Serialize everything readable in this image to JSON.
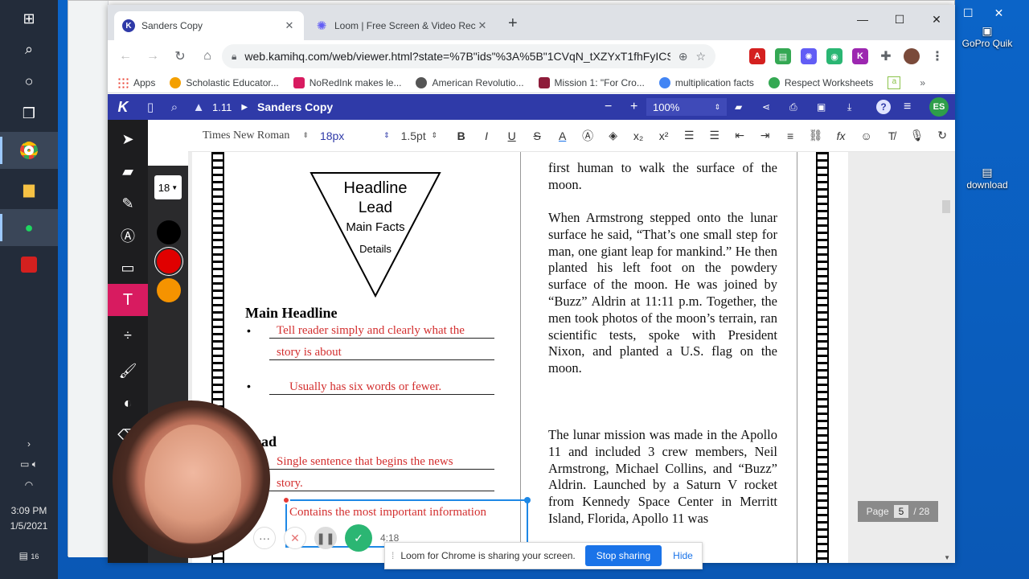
{
  "taskbar": {
    "time": "3:09 PM",
    "date": "1/5/2021",
    "notifications": "16"
  },
  "desktop": {
    "icons": [
      {
        "label": "GoPro Quik"
      },
      {
        "label": "download"
      }
    ]
  },
  "chrome": {
    "tabs": [
      {
        "title": "Sanders Copy",
        "icon": "K"
      },
      {
        "title": "Loom | Free Screen & Video Rec"
      }
    ],
    "url": "web.kamihq.com/web/viewer.html?state=%7B\"ids\"%3A%5B\"1CVqN_tXZYxT1fhFyICSS...",
    "profile": "ES",
    "bookmarks": [
      {
        "label": "Apps",
        "color": "#ea4335"
      },
      {
        "label": "Scholastic Educator...",
        "color": "#f4a000"
      },
      {
        "label": "NoRedInk makes le...",
        "color": "#d81b60"
      },
      {
        "label": "American Revolutio...",
        "color": "#555555"
      },
      {
        "label": "Mission 1: \"For Cro...",
        "color": "#8e1c3a"
      },
      {
        "label": "multiplication facts",
        "color": "#4285f4"
      },
      {
        "label": "Respect Worksheets",
        "color": "#34a853"
      }
    ]
  },
  "kami": {
    "breadcrumb_num": "1.11",
    "doc_title": "Sanders Copy",
    "zoom": "100%",
    "font": "Times New Roman",
    "font_size": "18px",
    "line_width": "1.5pt",
    "size_chip": "18",
    "page_label": "Page",
    "page_current": "5",
    "page_total": "/ 28"
  },
  "doc": {
    "pyramid": [
      "Headline",
      "Lead",
      "Main Facts",
      "Details"
    ],
    "main_headline": "Main Headline",
    "bullet1": "Tell reader simply and clearly what the",
    "bullet1b": "story is about",
    "bullet2": "Usually has six words or fewer.",
    "lead_heading": "ead",
    "lead1": "Single sentence that begins the news",
    "lead1b": "story.",
    "lead2": "Contains the most important information",
    "right_p0": "first human to walk the surface of the moon.",
    "right_p1": "When Armstrong stepped onto the lunar surface he said, “That’s one small step for man, one giant leap for mankind.” He then planted his left foot on the powdery surface of the moon. He was joined by “Buzz” Aldrin at 11:11 p.m. Together, the men took photos of the moon’s terrain, ran scientific tests, spoke with President Nixon, and planted a U.S. flag on the moon.",
    "right_p2": "The lunar mission was made in the Apollo 11 and included 3 crew members, Neil Armstrong, Michael Collins, and “Buzz” Aldrin. Launched by a Saturn V rocket from Kennedy Space Center in Merritt Island, Florida, Apollo 11 was"
  },
  "loom": {
    "message": "Loom for Chrome is sharing your screen.",
    "stop": "Stop sharing",
    "hide": "Hide",
    "timer": "4:18"
  },
  "colors": {
    "kami_blue": "#2f3aa8",
    "kami_pink": "#d81b60",
    "annotation_red": "#d32f2f"
  }
}
